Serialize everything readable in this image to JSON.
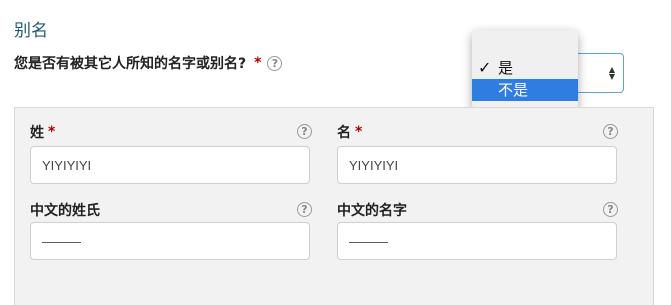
{
  "section": {
    "title": "别名"
  },
  "question": {
    "text": "您是否有被其它人所知的名字或别名?",
    "required_mark": "*",
    "help_glyph": "?"
  },
  "select": {
    "arrows_icon": "up-down-arrows-icon",
    "options": [
      {
        "label": "是",
        "checked": true,
        "check_glyph": "✓"
      },
      {
        "label": "不是",
        "highlighted": true
      }
    ]
  },
  "fields": {
    "surname": {
      "label": "姓",
      "required_mark": "*",
      "value": "YIYIYIYI"
    },
    "given_name": {
      "label": "名",
      "required_mark": "*",
      "value": "YIYIYIYI"
    },
    "chinese_surname": {
      "label": "中文的姓氏",
      "value": "———"
    },
    "chinese_given_name": {
      "label": "中文的名字",
      "value": "———"
    }
  },
  "help_glyph": "?",
  "colors": {
    "title": "#1d5c6e",
    "required": "#b00000",
    "select_border": "#57a7d6",
    "highlight": "#2f7de1",
    "panel_bg": "#f2f2f2"
  }
}
